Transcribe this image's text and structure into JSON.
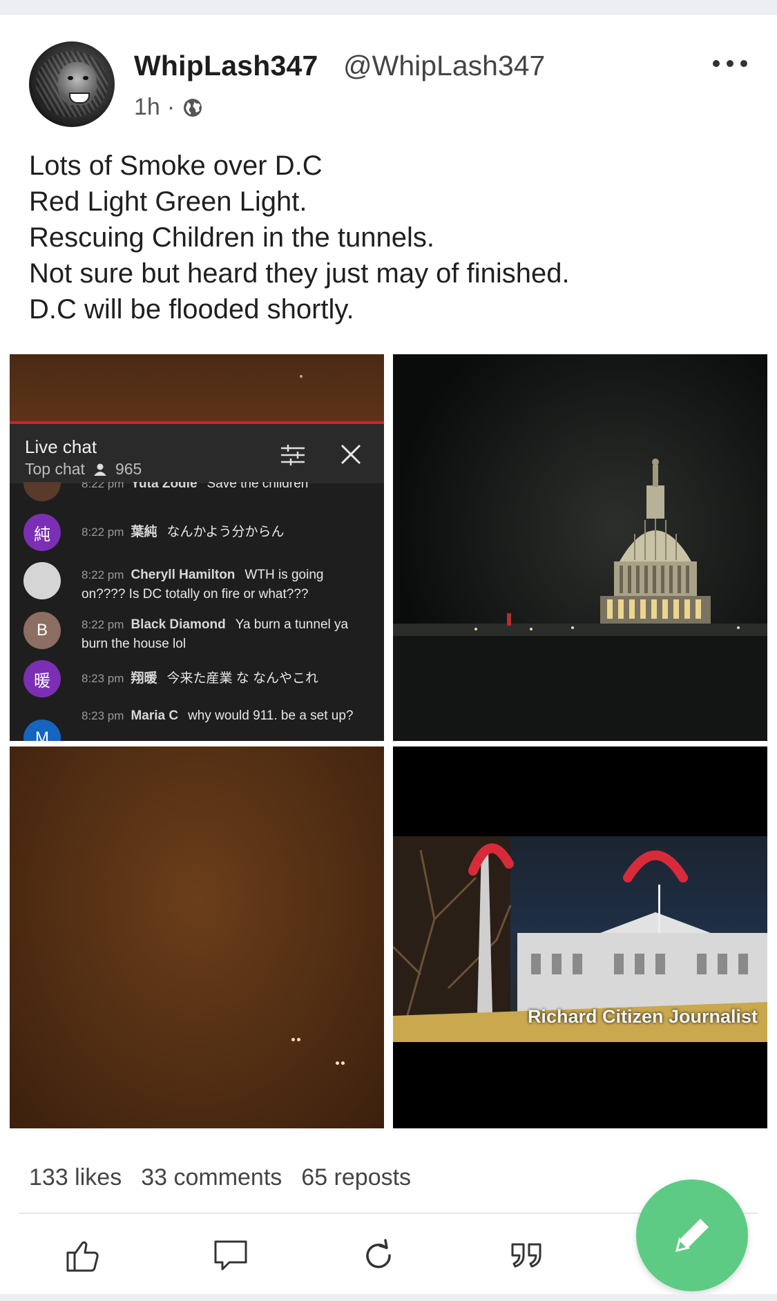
{
  "post": {
    "author_name": "WhipLash347",
    "author_handle": "@WhipLash347",
    "time": "1h",
    "separator": "·",
    "visibility_icon": "globe-icon",
    "more_icon": "more-horizontal-icon",
    "text_lines": [
      "Lots of Smoke over D.C",
      "Red Light Green Light.",
      "Rescuing Children in the tunnels.",
      "Not sure but heard they just may of finished.",
      "D.C will be flooded shortly."
    ]
  },
  "images": {
    "chat": {
      "title": "Live chat",
      "subtitle": "Top chat",
      "viewer_count": "965",
      "messages": [
        {
          "initial": "",
          "avatar_color": "#5a3a2a",
          "time": "8:22 pm",
          "author": "Yuta Zodie",
          "text": "Save the children"
        },
        {
          "initial": "純",
          "avatar_color": "#7b2fb5",
          "time": "8:22 pm",
          "author": "葉純",
          "text": "なんかよう分からん"
        },
        {
          "initial": "",
          "avatar_color": "#cfcfcf",
          "time": "8:22 pm",
          "author": "Cheryll Hamilton",
          "text": "WTH is going",
          "text2": "on???? Is DC totally on fire or what???"
        },
        {
          "initial": "B",
          "avatar_color": "#8d6e63",
          "time": "8:22 pm",
          "author": "Black Diamond",
          "text": "Ya burn a tunnel ya",
          "text2": "burn the house lol"
        },
        {
          "initial": "暖",
          "avatar_color": "#7b2fb5",
          "time": "8:23 pm",
          "author": "翔暖",
          "text": "今来た産業 な なんやこれ"
        },
        {
          "initial": "M",
          "avatar_color": "#1565c0",
          "time": "8:23 pm",
          "author": "Maria C",
          "text": "why would 911. be a set up?"
        }
      ]
    },
    "whitehouse_caption": "Richard Citizen Journalist"
  },
  "stats": {
    "likes": "133 likes",
    "comments": "33 comments",
    "reposts": "65 reposts"
  },
  "actions": {
    "like_icon": "thumbs-up-icon",
    "comment_icon": "comment-icon",
    "repost_icon": "repost-icon",
    "quote_icon": "quote-icon",
    "compose_icon": "pencil-icon"
  },
  "colors": {
    "fab": "#5ecb84",
    "chat_accent": "#c62828"
  }
}
